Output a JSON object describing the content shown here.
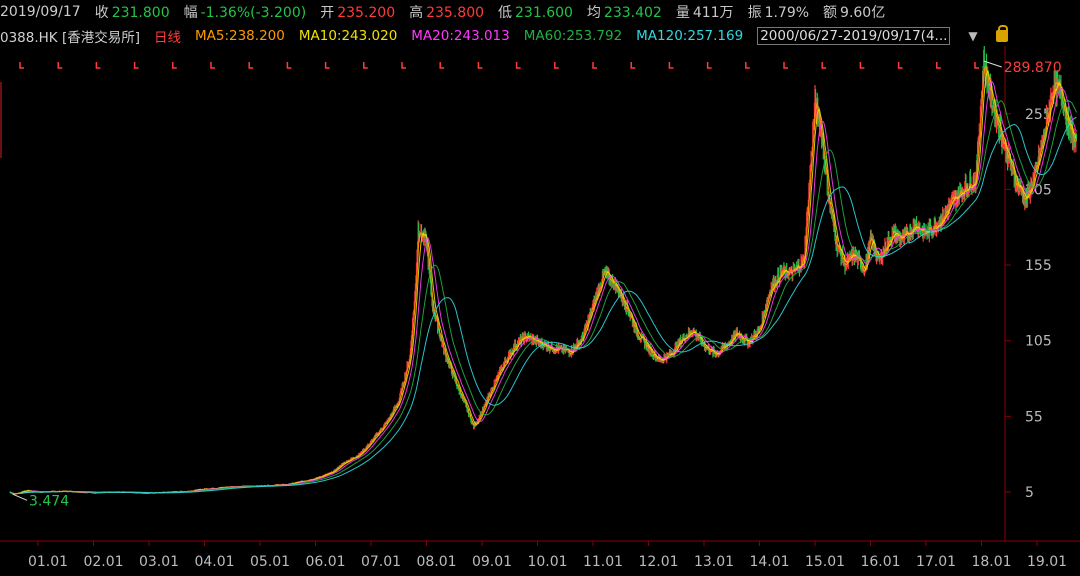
{
  "header": {
    "date": "2019/09/17",
    "close_label": "收",
    "close": "231.800",
    "change_label": "幅",
    "change": "-1.36%(-3.200)",
    "open_label": "开",
    "open": "235.200",
    "high_label": "高",
    "high": "235.800",
    "low_label": "低",
    "low": "231.600",
    "avg_label": "均",
    "avg": "233.402",
    "volume_label": "量",
    "volume": "411万",
    "amplitude_label": "振",
    "amplitude": "1.79%",
    "amount_label": "额",
    "amount": "9.60亿"
  },
  "mabar": {
    "symbol": "0388.HK [香港交易所]",
    "period": "日线",
    "ma5": "MA5:238.200",
    "ma10": "MA10:243.020",
    "ma20": "MA20:243.013",
    "ma60": "MA60:253.792",
    "ma120": "MA120:257.169",
    "range": "2000/06/27-2019/09/17(4..."
  },
  "colors": {
    "up": "#ff3b3b",
    "down": "#22c44a",
    "ma5": "#ff9a00",
    "ma10": "#f0e000",
    "ma20": "#ff38ff",
    "ma60": "#20b040",
    "ma120": "#30d8e0",
    "grid": "#4a0000",
    "axis": "#bbbbbb",
    "label_neutral": "#c8c8c8"
  },
  "chart_data": {
    "type": "line",
    "title": "",
    "xlabel": "",
    "ylabel": "",
    "x_ticks": [
      "01.01",
      "02.01",
      "03.01",
      "04.01",
      "05.01",
      "06.01",
      "07.01",
      "08.01",
      "09.01",
      "10.01",
      "11.01",
      "12.01",
      "13.01",
      "14.01",
      "15.01",
      "16.01",
      "17.01",
      "18.01",
      "19.01"
    ],
    "y_ticks": [
      5,
      55,
      105,
      155,
      205,
      255
    ],
    "ylim": [
      -10,
      290
    ],
    "annotations": {
      "max": {
        "x": 2018.04,
        "y": 289.87,
        "label": "289.870"
      },
      "min": {
        "x": 2000.55,
        "y": 3.474,
        "label": "3.474"
      }
    },
    "series": [
      {
        "name": "",
        "x": [
          2000.49,
          2000.55,
          2000.8,
          2001.0,
          2001.5,
          2002.0,
          2002.5,
          2003.0,
          2003.3,
          2003.7,
          2004.0,
          2004.5,
          2005.0,
          2005.5,
          2006.0,
          2006.3,
          2006.5,
          2006.8,
          2007.0,
          2007.3,
          2007.5,
          2007.7,
          2007.8,
          2007.85,
          2008.0,
          2008.1,
          2008.3,
          2008.5,
          2008.7,
          2008.85,
          2009.0,
          2009.2,
          2009.4,
          2009.6,
          2009.8,
          2010.0,
          2010.3,
          2010.6,
          2010.8,
          2011.0,
          2011.2,
          2011.4,
          2011.6,
          2011.8,
          2012.0,
          2012.2,
          2012.4,
          2012.6,
          2012.8,
          2013.0,
          2013.2,
          2013.4,
          2013.6,
          2013.8,
          2014.0,
          2014.2,
          2014.4,
          2014.6,
          2014.8,
          2015.0,
          2015.1,
          2015.25,
          2015.4,
          2015.55,
          2015.7,
          2015.9,
          2016.0,
          2016.15,
          2016.4,
          2016.6,
          2016.8,
          2017.0,
          2017.3,
          2017.5,
          2017.7,
          2017.9,
          2018.04,
          2018.2,
          2018.4,
          2018.6,
          2018.8,
          2018.95,
          2019.1,
          2019.3,
          2019.45,
          2019.55,
          2019.71
        ],
        "values": [
          5,
          3.474,
          6,
          5,
          5.5,
          4.5,
          5,
          4.2,
          4.8,
          5.5,
          7,
          8.5,
          9,
          10,
          14,
          18,
          24,
          30,
          38,
          52,
          65,
          95,
          140,
          180,
          170,
          130,
          100,
          80,
          62,
          48,
          58,
          75,
          90,
          102,
          108,
          104,
          100,
          98,
          106,
          128,
          150,
          142,
          128,
          110,
          100,
          92,
          96,
          106,
          112,
          102,
          96,
          102,
          110,
          104,
          112,
          140,
          150,
          150,
          158,
          262,
          248,
          198,
          168,
          155,
          162,
          152,
          172,
          158,
          176,
          172,
          182,
          176,
          186,
          198,
          206,
          212,
          289.87,
          262,
          236,
          212,
          198,
          212,
          236,
          274,
          268,
          250,
          231.8
        ]
      },
      {
        "name": "MA5",
        "values_last": 238.2
      },
      {
        "name": "MA10",
        "values_last": 243.02
      },
      {
        "name": "MA20",
        "values_last": 243.013
      },
      {
        "name": "MA60",
        "values_last": 253.792
      },
      {
        "name": "MA120",
        "values_last": 257.169
      }
    ]
  }
}
